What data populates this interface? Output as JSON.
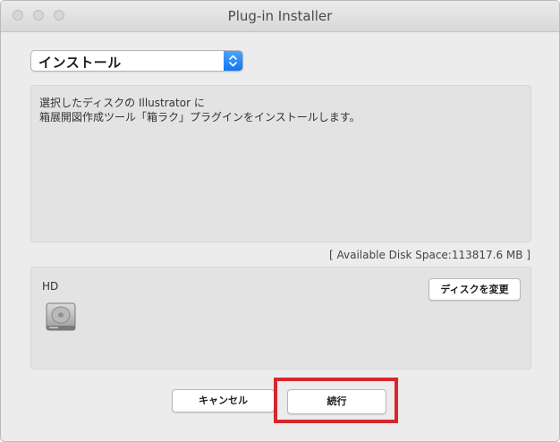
{
  "window": {
    "title": "Plug-in Installer"
  },
  "install_select": {
    "selected": "インストール"
  },
  "description": {
    "line1": "選択したディスクの Illustrator に",
    "line2": "箱展開図作成ツール「箱ラク」プラグインをインストールします。"
  },
  "disk_space": {
    "text": "[ Available Disk Space:113817.6 MB ]"
  },
  "disk": {
    "name": "HD",
    "icon": "hard-drive-icon",
    "change_label": "ディスクを変更"
  },
  "footer": {
    "cancel_label": "キャンセル",
    "continue_label": "続行"
  },
  "colors": {
    "highlight": "#d8262c",
    "select_accent": "#1376f0"
  }
}
